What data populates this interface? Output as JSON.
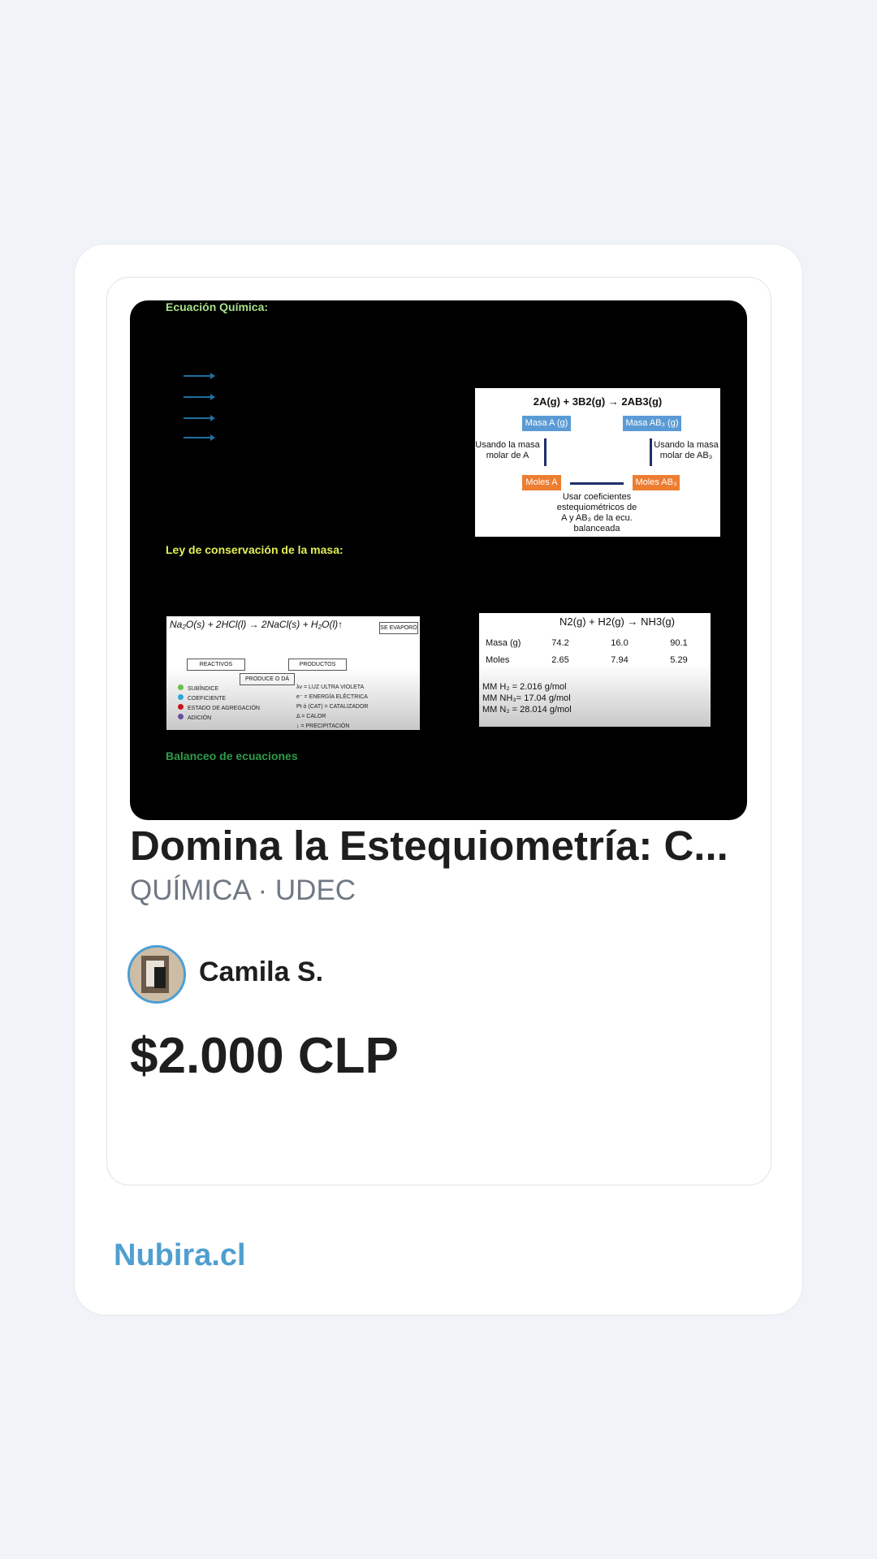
{
  "card": {
    "title": "Domina la Estequiometría: C...",
    "subtitle": "QUÍMICA · UDEC",
    "author": "Camila S.",
    "price": "$2.000 CLP"
  },
  "thumbnail": {
    "heading_1": "Ecuación Química:",
    "heading_2": "Ley de conservación de la masa:",
    "heading_3": "Balanceo de ecuaciones",
    "diagram": {
      "equation": "2A(g) + 3B2(g) → 2AB3(g)",
      "box_masa_a": "Masa A (g)",
      "box_masa_ab3": "Masa AB₃ (g)",
      "box_moles_a": "Moles A",
      "box_moles_ab3": "Moles AB₃",
      "label_left": "Usando la masa molar de A",
      "label_right": "Usando la masa molar de AB₃",
      "label_bottom": "Usar coeficientes estequiométricos de A y AB₃ de la ecu. balanceada"
    },
    "reaction": {
      "equation": "Na₂O(s) + 2HCl(l) → 2NaCl(s) + H₂O(l)↑",
      "evaporated": "SE EVAPORÓ",
      "reactivos": "REACTIVOS",
      "productos": "PRODUCTOS",
      "produce": "PRODUCE O DÁ",
      "legend_left": [
        "SUBÍNDICE",
        "COEFICIENTE",
        "ESTADO DE AGREGACIÓN",
        "ADICIÓN"
      ],
      "legend_right": [
        "λν = LUZ ULTRA VIOLETA",
        "e⁻ = ENERGÍA ELÉCTRICA",
        "Pt ó (CAT) = CATALIZADOR",
        "Δ = CALOR",
        "↓ = PRECIPITACIÓN"
      ],
      "legend_colors": [
        "#6abf45",
        "#2aa8d8",
        "#c4161c",
        "#6a4fa0"
      ]
    },
    "table": {
      "equation": "N2(g) + H2(g) → NH3(g)",
      "rows": [
        {
          "label": "Masa (g)",
          "values": [
            "74.2",
            "16.0",
            "90.1"
          ]
        },
        {
          "label": "Moles",
          "values": [
            "2.65",
            "7.94",
            "5.29"
          ]
        }
      ],
      "notes": [
        "MM H₂ = 2.016 g/mol",
        "MM NH₃= 17.04 g/mol",
        "MM N₂ = 28.014 g/mol"
      ]
    }
  },
  "footer": {
    "brand": "Nubira.cl"
  }
}
